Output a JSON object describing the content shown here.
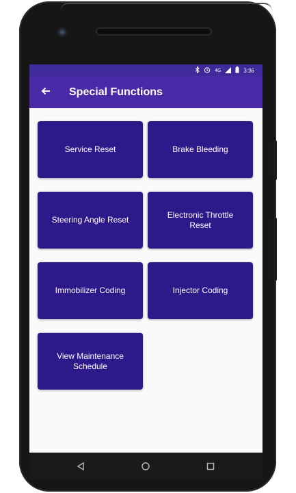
{
  "status_bar": {
    "bluetooth_icon": "bluetooth-icon",
    "alarm_icon": "alarm-icon",
    "network": "4G",
    "signal_icon": "signal-icon",
    "battery_icon": "battery-icon",
    "time": "3:36"
  },
  "app_bar": {
    "back_icon": "back-arrow-icon",
    "title": "Special Functions"
  },
  "functions": [
    {
      "label": "Service Reset"
    },
    {
      "label": "Brake Bleeding"
    },
    {
      "label": "Steering Angle Reset"
    },
    {
      "label": "Electronic Throttle Reset"
    },
    {
      "label": "Immobilizer Coding"
    },
    {
      "label": "Injector Coding"
    },
    {
      "label": "View Maintenance Schedule"
    }
  ],
  "nav_bar": {
    "back": "nav-back-icon",
    "home": "nav-home-icon",
    "recents": "nav-recents-icon"
  },
  "colors": {
    "status_bar": "#3f2a9a",
    "app_bar": "#4a2aa6",
    "button": "#2d198a",
    "screen_bg": "#fafafa"
  }
}
